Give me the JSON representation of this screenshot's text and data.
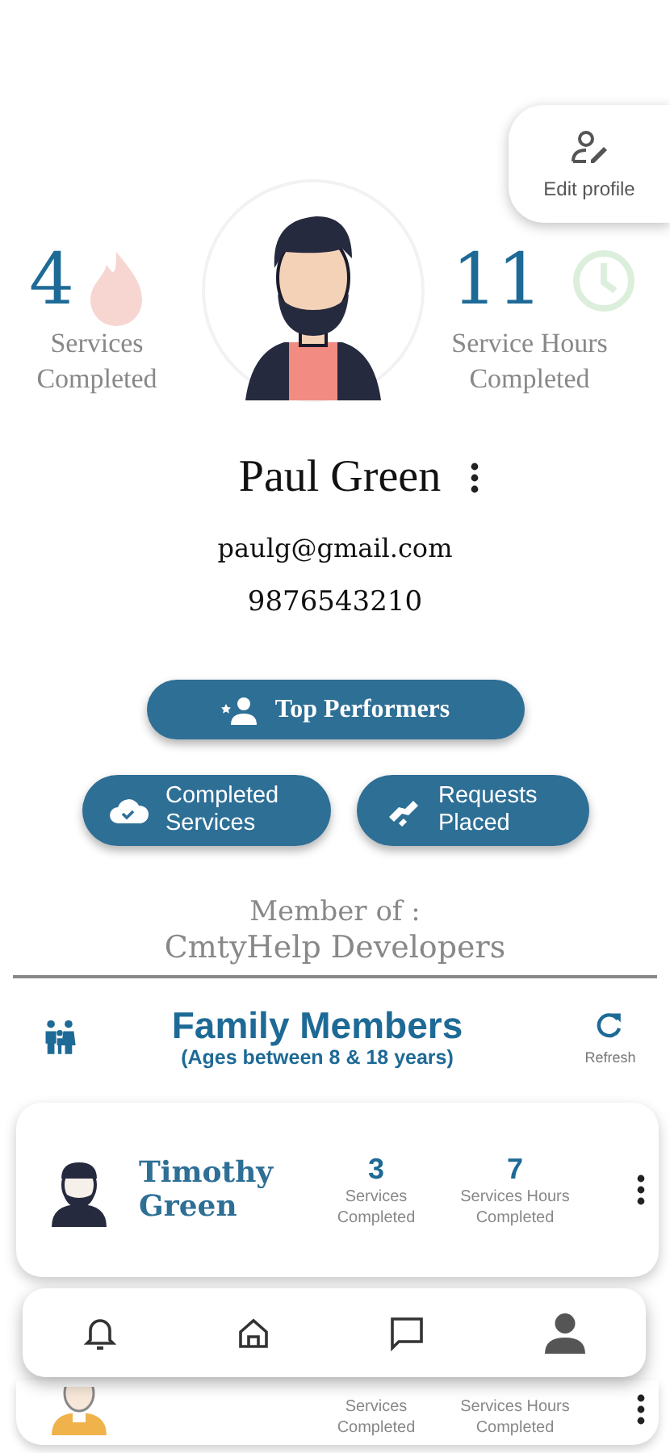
{
  "edit_profile": {
    "label": "Edit profile"
  },
  "stats": [
    {
      "value": "4",
      "label": "Services Completed"
    },
    {
      "value": "11",
      "label": "Service Hours Completed"
    }
  ],
  "user": {
    "name": "Paul Green",
    "email": "paulg@gmail.com",
    "phone": "9876543210"
  },
  "actions": [
    {
      "label": "Top Performers"
    },
    {
      "label": "Completed Services"
    },
    {
      "label": "Requests Placed"
    }
  ],
  "membership": {
    "label": "Member of :",
    "group": "CmtyHelp Developers"
  },
  "family": {
    "title": "Family Members",
    "subtitle": "(Ages between 8 & 18 years)",
    "refresh": "Refresh",
    "members": [
      {
        "name": "Timothy Green",
        "services": "3",
        "services_label": "Services Completed",
        "hours": "7",
        "hours_label": "Services Hours Completed"
      },
      {
        "services_label": "Services Completed",
        "hours_label": "Services Hours Completed"
      }
    ]
  },
  "nav": [
    {
      "selected": false
    },
    {
      "selected": false
    },
    {
      "selected": false
    },
    {
      "selected": true
    }
  ]
}
